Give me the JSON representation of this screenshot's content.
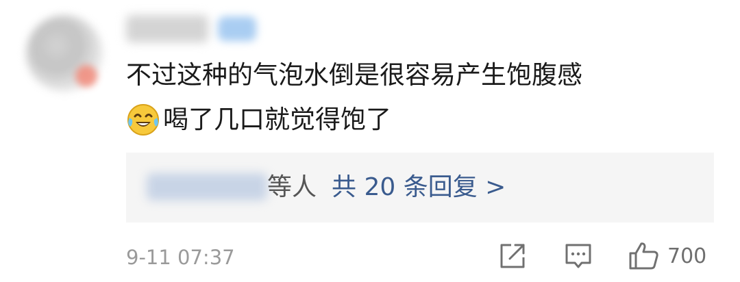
{
  "comment": {
    "text_line1": "不过这种的气泡水倒是很容易产生饱腹感",
    "text_line2": "喝了几口就觉得饱了",
    "emoji": "laughing-crying-emoji"
  },
  "replies": {
    "suffix": "等人",
    "link_label": "共 20 条回复 >"
  },
  "meta": {
    "timestamp": "9-11 07:37",
    "like_count": "700"
  },
  "colors": {
    "link": "#3a5b8e",
    "reply_bg": "#f5f5f5",
    "muted": "#9a9a9a"
  },
  "icons": [
    "share-icon",
    "comment-icon",
    "thumbs-up-icon"
  ]
}
